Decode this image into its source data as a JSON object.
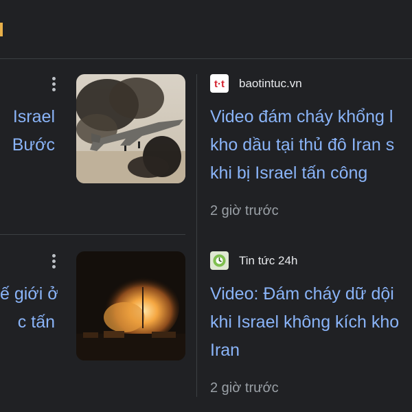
{
  "left_column": {
    "cards": [
      {
        "title_lines": [
          "Israel",
          "Bước"
        ]
      },
      {
        "title_lines": [
          "ế giới ở",
          "c tấn"
        ]
      }
    ]
  },
  "right_column": {
    "cards": [
      {
        "source": "baotintuc.vn",
        "source_icon": "baotintuc-logo-icon",
        "headline_lines": [
          "Video đám cháy khổng l",
          "kho dầu tại thủ đô Iran s",
          "khi bị Israel tấn công"
        ],
        "time": "2 giờ trước"
      },
      {
        "source": "Tin tức 24h",
        "source_icon": "tintuc24h-logo-icon",
        "headline_lines": [
          "Video: Đám cháy dữ dội",
          "khi Israel không kích kho",
          "Iran"
        ],
        "time": "2 giờ trước"
      }
    ]
  },
  "colors": {
    "background": "#202124",
    "link": "#8ab4f8",
    "muted": "#9aa0a6",
    "divider": "#3c4043"
  }
}
